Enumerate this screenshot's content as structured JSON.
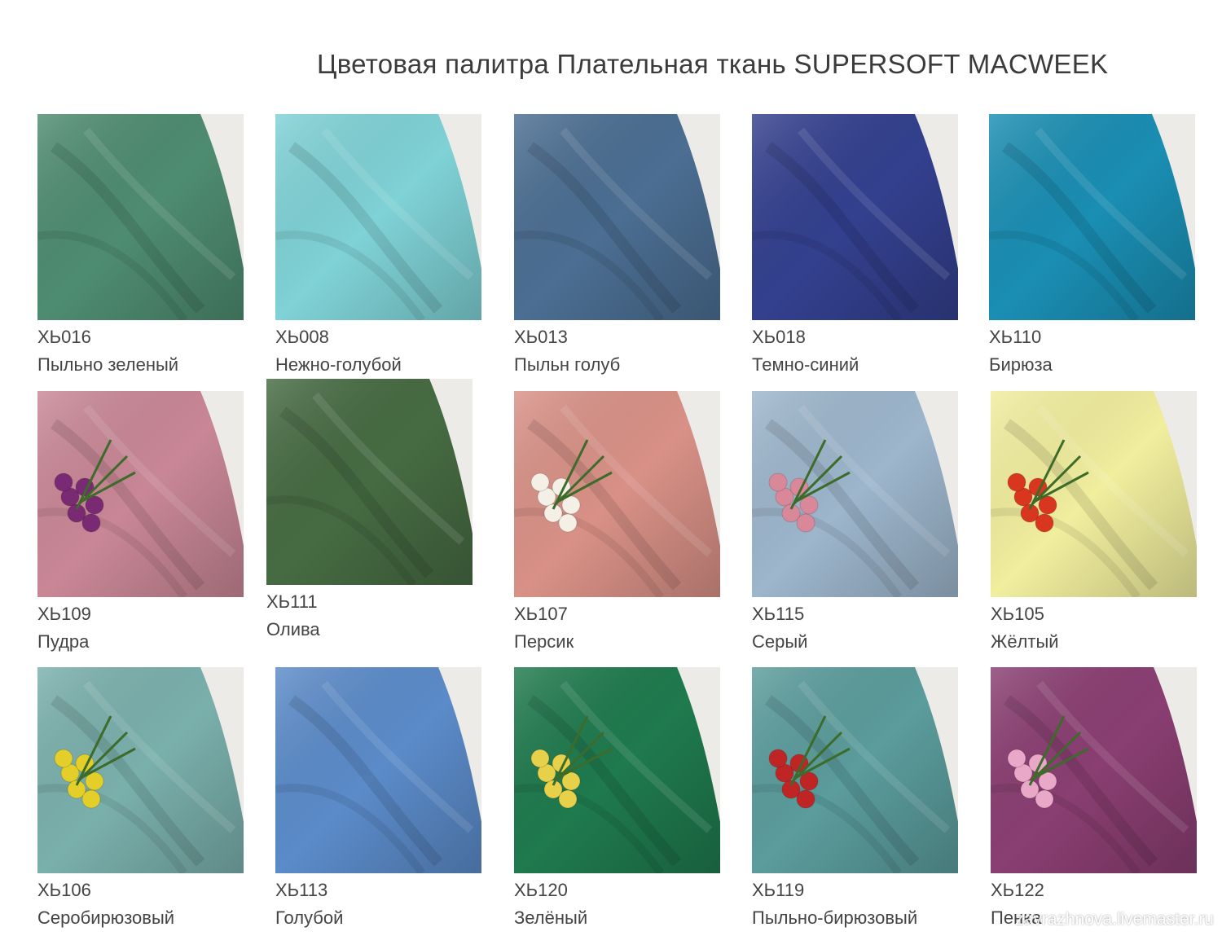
{
  "title": "Цветовая палитра Плательная ткань SUPERSOFT MACWEEK",
  "watermark": "zavrazhnova.livemaster.ru",
  "swatches": [
    {
      "code": "ХЬ016",
      "name": "Пыльно зеленый",
      "color": "#4e8c70",
      "flower": ""
    },
    {
      "code": "ХЬ008",
      "name": "Нежно-голубой",
      "color": "#7fd2d6",
      "flower": ""
    },
    {
      "code": "ХЬ013",
      "name": "Пыльн голуб",
      "color": "#4b6e92",
      "flower": ""
    },
    {
      "code": "ХЬ018",
      "name": "Темно-синий",
      "color": "#33408e",
      "flower": ""
    },
    {
      "code": "ХЬ110",
      "name": "Бирюза",
      "color": "#1a8eb3",
      "flower": ""
    },
    {
      "code": "ХЬ109",
      "name": "Пудра",
      "color": "#c98796",
      "flower": "#7a2a72"
    },
    {
      "code": "ХЬ111",
      "name": "Олива",
      "color": "#466b42",
      "flower": ""
    },
    {
      "code": "ХЬ107",
      "name": "Персик",
      "color": "#d99187",
      "flower": "#f4f0e6"
    },
    {
      "code": "ХЬ115",
      "name": "Серый",
      "color": "#9db6cc",
      "flower": "#d9889a"
    },
    {
      "code": "ХЬ105",
      "name": "Жёлтый",
      "color": "#f1ee9e",
      "flower": "#d8361e"
    },
    {
      "code": "ХЬ106",
      "name": "Серобирюзовый",
      "color": "#7ab0ac",
      "flower": "#e4cf2a"
    },
    {
      "code": "ХЬ113",
      "name": "Голубой",
      "color": "#5b8bc9",
      "flower": ""
    },
    {
      "code": "ХЬ120",
      "name": "Зелёный",
      "color": "#1f7a4e",
      "flower": "#e7d14a"
    },
    {
      "code": "ХЬ119",
      "name": "Пыльно-бирюзовый",
      "color": "#5b9c9c",
      "flower": "#c02526"
    },
    {
      "code": "ХЬ122",
      "name": "Пенка",
      "color": "#8a3e72",
      "flower": "#e9a8c8"
    }
  ]
}
